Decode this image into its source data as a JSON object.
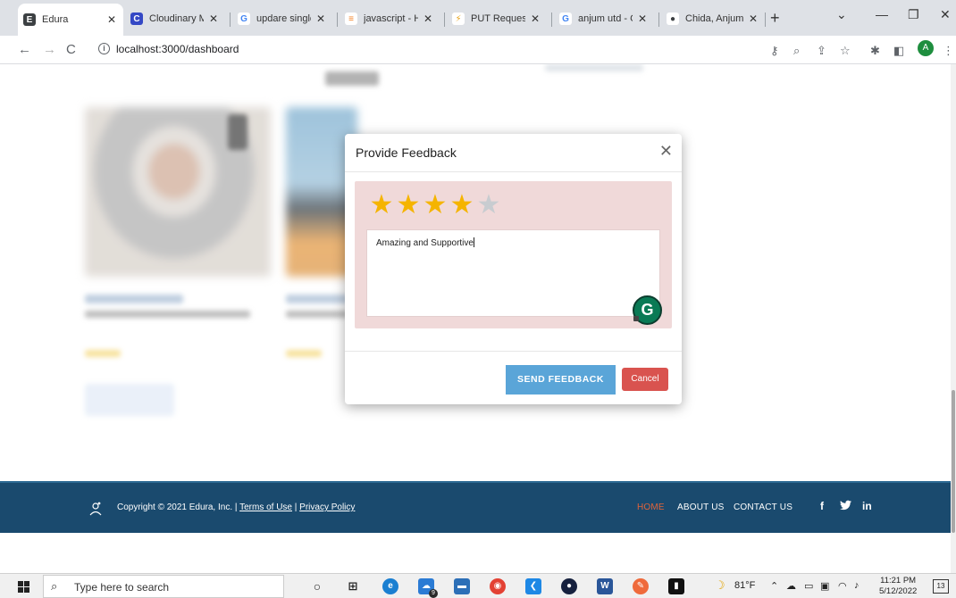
{
  "browser": {
    "tabs": [
      {
        "label": "Edura",
        "close": "✕",
        "color": "#3c4043",
        "glyph": "E"
      },
      {
        "label": "Cloudinary Ma",
        "close": "✕",
        "color": "#3448c5",
        "glyph": "C"
      },
      {
        "label": "updare single",
        "close": "✕",
        "color": "#4285f4",
        "glyph": "G"
      },
      {
        "label": "javascript - Ho",
        "close": "✕",
        "color": "#f48024",
        "glyph": "≡"
      },
      {
        "label": "PUT Requests",
        "close": "✕",
        "color": "#e8a317",
        "glyph": "⚡"
      },
      {
        "label": "anjum utd - G",
        "close": "✕",
        "color": "#4285f4",
        "glyph": "G"
      },
      {
        "label": "Chida, Anjum",
        "close": "✕",
        "color": "#3c4043",
        "glyph": "●"
      }
    ],
    "new_tab": "+",
    "url": "localhost:3000/dashboard",
    "profile_initial": "A"
  },
  "modal": {
    "title": "Provide Feedback",
    "close": "✕",
    "rating": 4,
    "max_rating": 5,
    "star_glyph": "★",
    "feedback_text": "Amazing and Supportive",
    "grammarly_glyph": "G",
    "send_label": "SEND FEEDBACK",
    "cancel_label": "Cancel"
  },
  "footer": {
    "copyright": "Copyright © 2021 Edura, Inc. |",
    "terms": "Terms of Use",
    "separator": "|",
    "privacy": "Privacy Policy",
    "nav": [
      "HOME",
      "ABOUT US",
      "CONTACT US"
    ],
    "social": [
      "f",
      "𝕏",
      "in"
    ]
  },
  "taskbar": {
    "search_placeholder": "Type here to search",
    "weather": "81°F",
    "time": "11:21 PM",
    "date": "5/12/2022",
    "notifications": "13",
    "badge": "9"
  },
  "colors": {
    "accent_blue": "#5aa5d8",
    "cancel_red": "#d9534f",
    "footer_bg": "#1a4a6e",
    "star_on": "#f5b400",
    "panel_pink": "#f0d9d9"
  }
}
